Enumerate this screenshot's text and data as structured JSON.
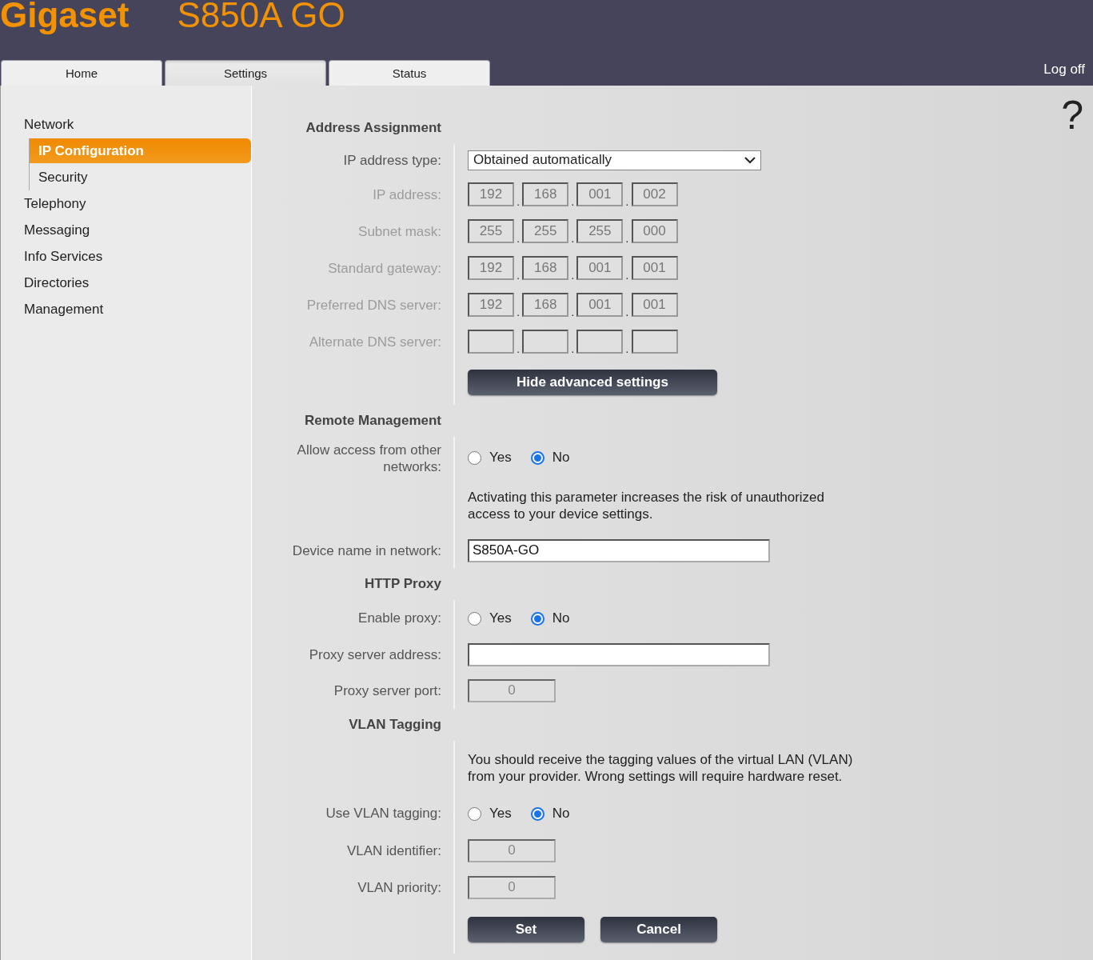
{
  "header": {
    "brand": "Gigaset",
    "model": "S850A GO",
    "logoff": "Log off"
  },
  "tabs": [
    {
      "label": "Home",
      "selected": false
    },
    {
      "label": "Settings",
      "selected": true
    },
    {
      "label": "Status",
      "selected": false
    }
  ],
  "sidebar": {
    "items": [
      {
        "label": "Network",
        "selected": false,
        "children": [
          {
            "label": "IP Configuration",
            "selected": true
          },
          {
            "label": "Security",
            "selected": false
          }
        ]
      },
      {
        "label": "Telephony",
        "selected": false
      },
      {
        "label": "Messaging",
        "selected": false
      },
      {
        "label": "Info Services",
        "selected": false
      },
      {
        "label": "Directories",
        "selected": false
      },
      {
        "label": "Management",
        "selected": false
      }
    ]
  },
  "help": "?",
  "sections": [
    {
      "title": "Address Assignment",
      "rows": [
        {
          "kind": "select",
          "label": "IP address type:",
          "value": "Obtained automatically"
        },
        {
          "kind": "ip",
          "label": "IP address:",
          "disabled": true,
          "separator": ".",
          "octets": [
            {
              "value": "192",
              "disabled": true
            },
            {
              "value": "168",
              "disabled": true
            },
            {
              "value": "001",
              "disabled": true
            },
            {
              "value": "002",
              "disabled": true
            }
          ]
        },
        {
          "kind": "ip",
          "label": "Subnet mask:",
          "disabled": true,
          "separator": ".",
          "octets": [
            {
              "value": "255",
              "disabled": true
            },
            {
              "value": "255",
              "disabled": true
            },
            {
              "value": "255",
              "disabled": true
            },
            {
              "value": "000",
              "disabled": true
            }
          ]
        },
        {
          "kind": "ip",
          "label": "Standard gateway:",
          "disabled": true,
          "separator": ".",
          "octets": [
            {
              "value": "192",
              "disabled": true
            },
            {
              "value": "168",
              "disabled": true
            },
            {
              "value": "001",
              "disabled": true
            },
            {
              "value": "001",
              "disabled": true
            }
          ]
        },
        {
          "kind": "ip",
          "label": "Preferred DNS server:",
          "disabled": true,
          "separator": ".",
          "octets": [
            {
              "value": "192",
              "disabled": true
            },
            {
              "value": "168",
              "disabled": true
            },
            {
              "value": "001",
              "disabled": true
            },
            {
              "value": "001",
              "disabled": true
            }
          ]
        },
        {
          "kind": "ip",
          "label": "Alternate DNS server:",
          "disabled": true,
          "separator": ".",
          "octets": [
            {
              "disabled": true
            },
            {
              "disabled": true
            },
            {
              "disabled": true
            },
            {
              "disabled": true
            }
          ]
        },
        {
          "kind": "button",
          "text": "Hide advanced settings"
        }
      ]
    },
    {
      "title": "Remote Management",
      "rows": [
        {
          "kind": "radio",
          "label": "Allow access from other networks:",
          "options": [
            {
              "label": "Yes",
              "selected": false
            },
            {
              "label": "No",
              "selected": true
            }
          ]
        },
        {
          "kind": "note",
          "text": "Activating this parameter increases the risk of unauthorized access to your device settings."
        },
        {
          "kind": "text",
          "label": "Device name in network:",
          "value": "S850A-GO"
        }
      ]
    },
    {
      "title": "HTTP Proxy",
      "rows": [
        {
          "kind": "radio",
          "label": "Enable proxy:",
          "options": [
            {
              "label": "Yes",
              "selected": false
            },
            {
              "label": "No",
              "selected": true
            }
          ]
        },
        {
          "kind": "text",
          "label": "Proxy server address:"
        },
        {
          "kind": "number",
          "label": "Proxy server port:",
          "value": "0",
          "disabled": true
        }
      ]
    },
    {
      "title": "VLAN Tagging",
      "rows": [
        {
          "kind": "note",
          "text": "You should receive the tagging values of the virtual LAN (VLAN) from your provider. Wrong settings will require hardware reset."
        },
        {
          "kind": "radio",
          "label": "Use VLAN tagging:",
          "options": [
            {
              "label": "Yes",
              "selected": false
            },
            {
              "label": "No",
              "selected": true
            }
          ]
        },
        {
          "kind": "number",
          "label": "VLAN identifier:",
          "value": "0",
          "disabled": true
        },
        {
          "kind": "number",
          "label": "VLAN priority:",
          "value": "0",
          "disabled": true
        }
      ]
    }
  ],
  "actions": [
    "Set",
    "Cancel"
  ]
}
